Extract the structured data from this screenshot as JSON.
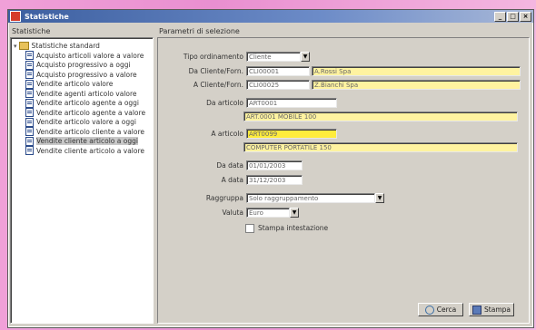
{
  "window": {
    "title": "Statistiche"
  },
  "left_panel": {
    "caption": "Statistiche",
    "root": "Statistiche standard",
    "items": [
      "Acquisto articoli valore a valore",
      "Acquisto progressivo a oggi",
      "Acquisto progressivo a valore",
      "Vendite articolo valore",
      "Vendite agenti articolo valore",
      "Vendite articolo agente a oggi",
      "Vendite articolo agente a valore",
      "Vendite articolo valore a oggi",
      "Vendite articolo cliente a valore",
      "Vendite cliente articolo a oggi",
      "Vendite cliente articolo a valore"
    ],
    "selected_index": 9
  },
  "right_panel": {
    "caption": "Parametri di selezione",
    "fields": {
      "tipo_ordinamento": {
        "label": "Tipo ordinamento",
        "value": "Cliente"
      },
      "da_cliente": {
        "label": "Da Cliente/Forn.",
        "code": "CLI00001",
        "name": "A.Rossi Spa"
      },
      "a_cliente": {
        "label": "A Cliente/Forn.",
        "code": "CLI00025",
        "name": "Z.Bianchi Spa"
      },
      "da_articolo": {
        "label": "Da articolo",
        "code": "ART0001",
        "desc": "ART.0001 MOBILE 100"
      },
      "a_articolo": {
        "label": "A articolo",
        "code": "ART0099",
        "desc": "COMPUTER PORTATILE 150"
      },
      "da_data": {
        "label": "Da data",
        "value": "01/01/2003"
      },
      "a_data": {
        "label": "A data",
        "value": "31/12/2003"
      },
      "raggruppa": {
        "label": "Raggruppa",
        "value": "Solo raggruppamento"
      },
      "valuta": {
        "label": "Valuta",
        "value": "Euro"
      },
      "stampa": {
        "label": "Stampa intestazione"
      }
    },
    "buttons": {
      "search": "Cerca",
      "print": "Stampa"
    }
  }
}
